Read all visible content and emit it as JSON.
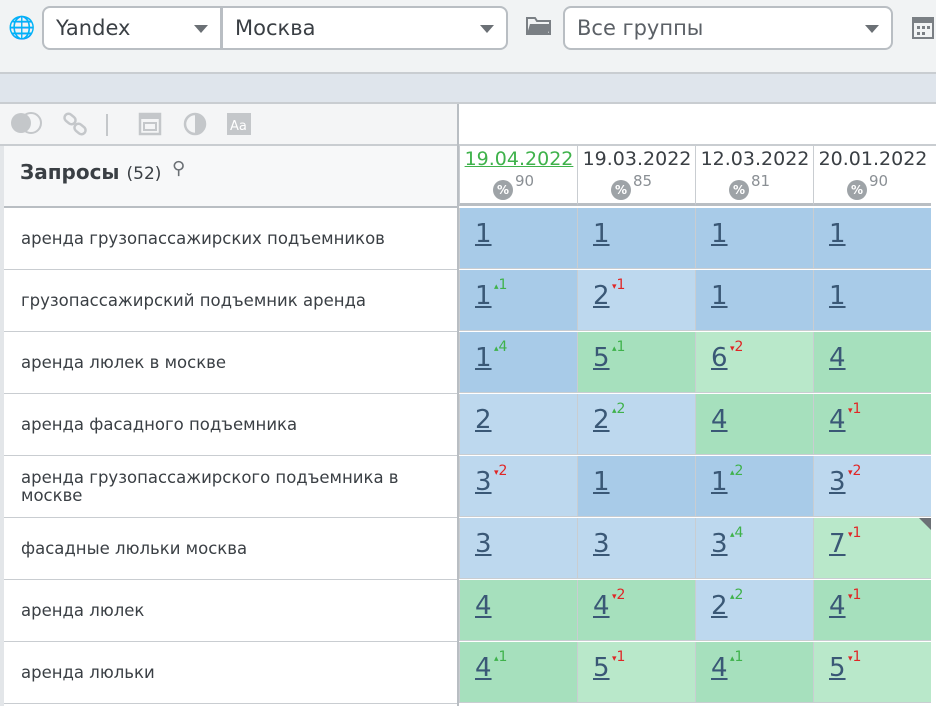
{
  "toolbar": {
    "search_engine": "Yandex",
    "region": "Москва",
    "group": "Все группы"
  },
  "table": {
    "title": "Запросы",
    "count": "(52)",
    "dates": [
      {
        "date": "19.04.2022",
        "percent": "90",
        "active": true
      },
      {
        "date": "19.03.2022",
        "percent": "85",
        "active": false
      },
      {
        "date": "12.03.2022",
        "percent": "81",
        "active": false
      },
      {
        "date": "20.01.2022",
        "percent": "90",
        "active": false
      }
    ],
    "colors": {
      "blue_dark": "#a8cbe8",
      "blue_light": "#bdd8ee",
      "green_dark": "#a6e0bd",
      "green_light": "#b9e8ca",
      "up": "#3fb24b",
      "down": "#e02626"
    },
    "rows": [
      {
        "keyword": "аренда грузопассажирских подъемников",
        "cells": [
          {
            "pos": "1",
            "chg": "",
            "dir": "",
            "bg": "blue_dark"
          },
          {
            "pos": "1",
            "chg": "",
            "dir": "",
            "bg": "blue_dark"
          },
          {
            "pos": "1",
            "chg": "",
            "dir": "",
            "bg": "blue_dark"
          },
          {
            "pos": "1",
            "chg": "",
            "dir": "",
            "bg": "blue_dark"
          }
        ]
      },
      {
        "keyword": "грузопассажирский подъемник аренда",
        "cells": [
          {
            "pos": "1",
            "chg": "1",
            "dir": "up",
            "bg": "blue_dark"
          },
          {
            "pos": "2",
            "chg": "1",
            "dir": "down",
            "bg": "blue_light"
          },
          {
            "pos": "1",
            "chg": "",
            "dir": "",
            "bg": "blue_dark"
          },
          {
            "pos": "1",
            "chg": "",
            "dir": "",
            "bg": "blue_dark"
          }
        ]
      },
      {
        "keyword": "аренда люлек в москве",
        "cells": [
          {
            "pos": "1",
            "chg": "4",
            "dir": "up",
            "bg": "blue_dark"
          },
          {
            "pos": "5",
            "chg": "1",
            "dir": "up",
            "bg": "green_dark"
          },
          {
            "pos": "6",
            "chg": "2",
            "dir": "down",
            "bg": "green_light"
          },
          {
            "pos": "4",
            "chg": "",
            "dir": "",
            "bg": "green_dark"
          }
        ]
      },
      {
        "keyword": "аренда фасадного подъемника",
        "cells": [
          {
            "pos": "2",
            "chg": "",
            "dir": "",
            "bg": "blue_light"
          },
          {
            "pos": "2",
            "chg": "2",
            "dir": "up",
            "bg": "blue_light"
          },
          {
            "pos": "4",
            "chg": "",
            "dir": "",
            "bg": "green_dark"
          },
          {
            "pos": "4",
            "chg": "1",
            "dir": "down",
            "bg": "green_dark"
          }
        ]
      },
      {
        "keyword": "аренда грузопассажирского подъемника в москве",
        "cells": [
          {
            "pos": "3",
            "chg": "2",
            "dir": "down",
            "bg": "blue_light"
          },
          {
            "pos": "1",
            "chg": "",
            "dir": "",
            "bg": "blue_dark"
          },
          {
            "pos": "1",
            "chg": "2",
            "dir": "up",
            "bg": "blue_dark"
          },
          {
            "pos": "3",
            "chg": "2",
            "dir": "down",
            "bg": "blue_light"
          }
        ]
      },
      {
        "keyword": "фасадные люльки москва",
        "cells": [
          {
            "pos": "3",
            "chg": "",
            "dir": "",
            "bg": "blue_light"
          },
          {
            "pos": "3",
            "chg": "",
            "dir": "",
            "bg": "blue_light"
          },
          {
            "pos": "3",
            "chg": "4",
            "dir": "up",
            "bg": "blue_light"
          },
          {
            "pos": "7",
            "chg": "1",
            "dir": "down",
            "bg": "green_light",
            "corner": true
          }
        ]
      },
      {
        "keyword": "аренда люлек",
        "cells": [
          {
            "pos": "4",
            "chg": "",
            "dir": "",
            "bg": "green_dark"
          },
          {
            "pos": "4",
            "chg": "2",
            "dir": "down",
            "bg": "green_dark"
          },
          {
            "pos": "2",
            "chg": "2",
            "dir": "up",
            "bg": "blue_light"
          },
          {
            "pos": "4",
            "chg": "1",
            "dir": "down",
            "bg": "green_dark"
          }
        ]
      },
      {
        "keyword": "аренда люльки",
        "cells": [
          {
            "pos": "4",
            "chg": "1",
            "dir": "up",
            "bg": "green_dark"
          },
          {
            "pos": "5",
            "chg": "1",
            "dir": "down",
            "bg": "green_light"
          },
          {
            "pos": "4",
            "chg": "1",
            "dir": "up",
            "bg": "green_dark"
          },
          {
            "pos": "5",
            "chg": "1",
            "dir": "down",
            "bg": "green_light"
          }
        ]
      }
    ]
  }
}
